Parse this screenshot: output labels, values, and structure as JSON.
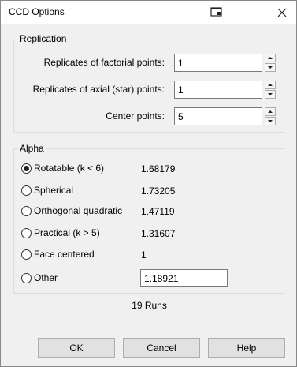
{
  "window": {
    "title": "CCD Options",
    "title_icon": "window-icon",
    "close_icon": "close-icon"
  },
  "replication": {
    "group_label": "Replication",
    "rows": [
      {
        "label": "Replicates of factorial points:",
        "value": "1"
      },
      {
        "label": "Replicates of axial (star) points:",
        "value": "1"
      },
      {
        "label": "Center points:",
        "value": "5"
      }
    ]
  },
  "alpha": {
    "group_label": "Alpha",
    "selected": "Rotatable (k < 6)",
    "options": [
      {
        "label": "Rotatable (k < 6)",
        "value": "1.68179",
        "checked": true
      },
      {
        "label": "Spherical",
        "value": "1.73205",
        "checked": false
      },
      {
        "label": "Orthogonal quadratic",
        "value": "1.47119",
        "checked": false
      },
      {
        "label": "Practical (k > 5)",
        "value": "1.31607",
        "checked": false
      },
      {
        "label": "Face centered",
        "value": "1",
        "checked": false
      },
      {
        "label": "Other",
        "value": "1.18921",
        "checked": false
      }
    ]
  },
  "runs_text": "19 Runs",
  "buttons": {
    "ok": "OK",
    "cancel": "Cancel",
    "help": "Help"
  }
}
